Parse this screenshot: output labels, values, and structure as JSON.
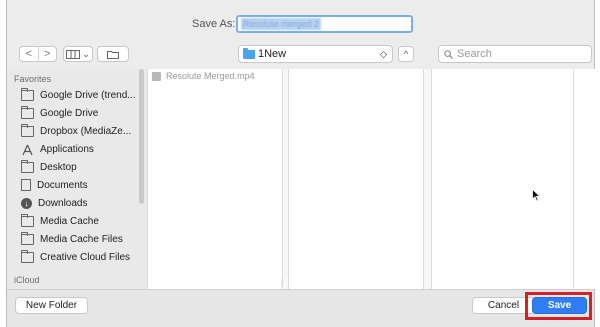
{
  "dialog": {
    "save_as_label": "Save As:",
    "filename_value": "Resolute merged 2"
  },
  "toolbar": {
    "back": "<",
    "forward": ">",
    "view_chevron": "⌄",
    "location": "1New",
    "location_chevron": "◇",
    "expand": "^",
    "search_placeholder": "Search"
  },
  "sidebar": {
    "favorites_header": "Favorites",
    "items": [
      {
        "label": "Google Drive (trend...",
        "icon": "folder-icon"
      },
      {
        "label": "Google Drive",
        "icon": "folder-icon"
      },
      {
        "label": "Dropbox (MediaZe...",
        "icon": "folder-icon"
      },
      {
        "label": "Applications",
        "icon": "applications-icon"
      },
      {
        "label": "Desktop",
        "icon": "folder-icon"
      },
      {
        "label": "Documents",
        "icon": "document-icon"
      },
      {
        "label": "Downloads",
        "icon": "download-icon"
      },
      {
        "label": "Media Cache",
        "icon": "folder-icon"
      },
      {
        "label": "Media Cache Files",
        "icon": "folder-icon"
      },
      {
        "label": "Creative Cloud Files",
        "icon": "folder-icon"
      }
    ],
    "icloud_header": "iCloud"
  },
  "browser": {
    "files": [
      "Resolute Merged.mp4"
    ]
  },
  "buttons": {
    "new_folder": "New Folder",
    "cancel": "Cancel",
    "save": "Save"
  },
  "colors": {
    "accent": "#2f7ef5",
    "highlight": "#d42127"
  }
}
